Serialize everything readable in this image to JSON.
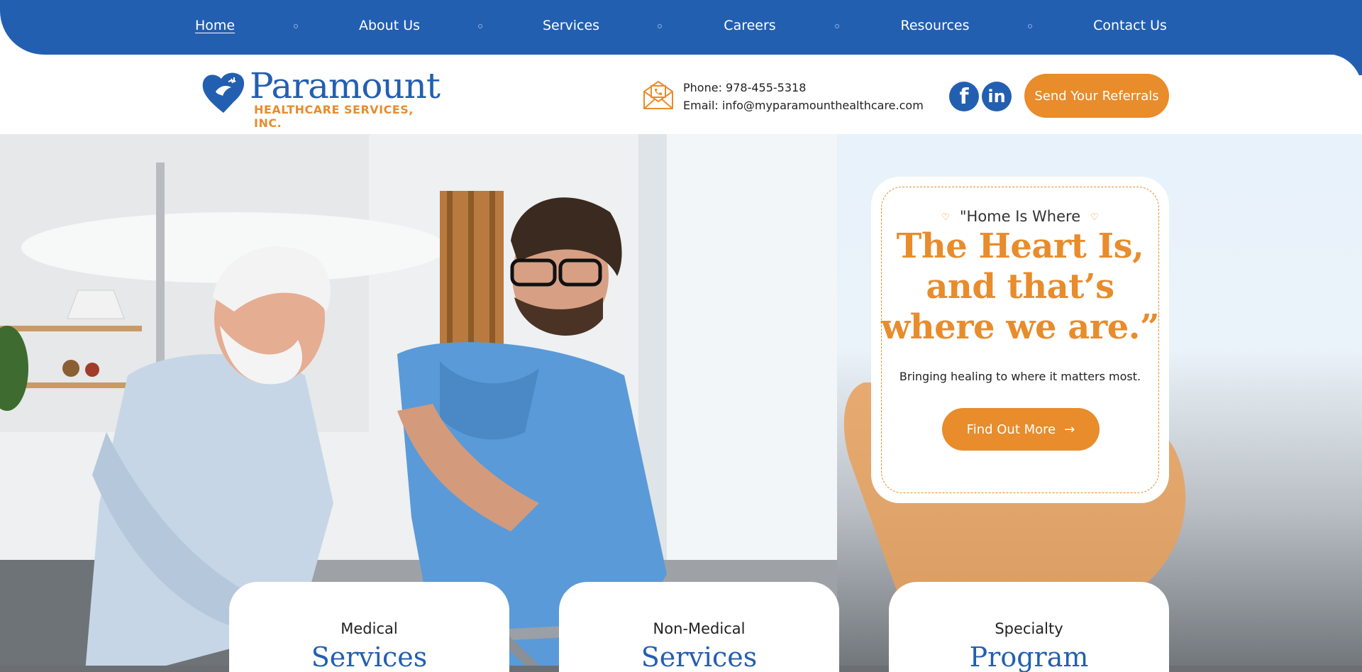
{
  "nav": {
    "items": [
      "Home",
      "About Us",
      "Services",
      "Careers",
      "Resources",
      "Contact Us"
    ],
    "active": "Home"
  },
  "brand": {
    "name": "Paramount",
    "subtitle": "HEALTHCARE SERVICES, INC."
  },
  "contact": {
    "phone": "Phone: 978-455-5318",
    "email": "Email: info@myparamounthealthcare.com"
  },
  "social": {
    "facebook": "f",
    "linkedin": "in"
  },
  "header": {
    "referral_button": "Send Your Referrals"
  },
  "hero": {
    "quote_intro": "\"Home Is Where",
    "quote_line1": "The Heart Is,",
    "quote_line2": "and that’s",
    "quote_line3": "where we are.”",
    "tagline": "Bringing healing to where it matters most.",
    "cta": "Find Out More",
    "cta_arrow": "→"
  },
  "services": [
    {
      "small": "Medical",
      "big": "Services"
    },
    {
      "small": "Non-Medical",
      "big": "Services"
    },
    {
      "small": "Specialty",
      "big": "Program"
    }
  ],
  "colors": {
    "brand_blue": "#235fb1",
    "accent_orange": "#e88c2c"
  },
  "icons": {
    "contact": "envelope-phone-icon",
    "heart": "heart-outline-icon"
  }
}
